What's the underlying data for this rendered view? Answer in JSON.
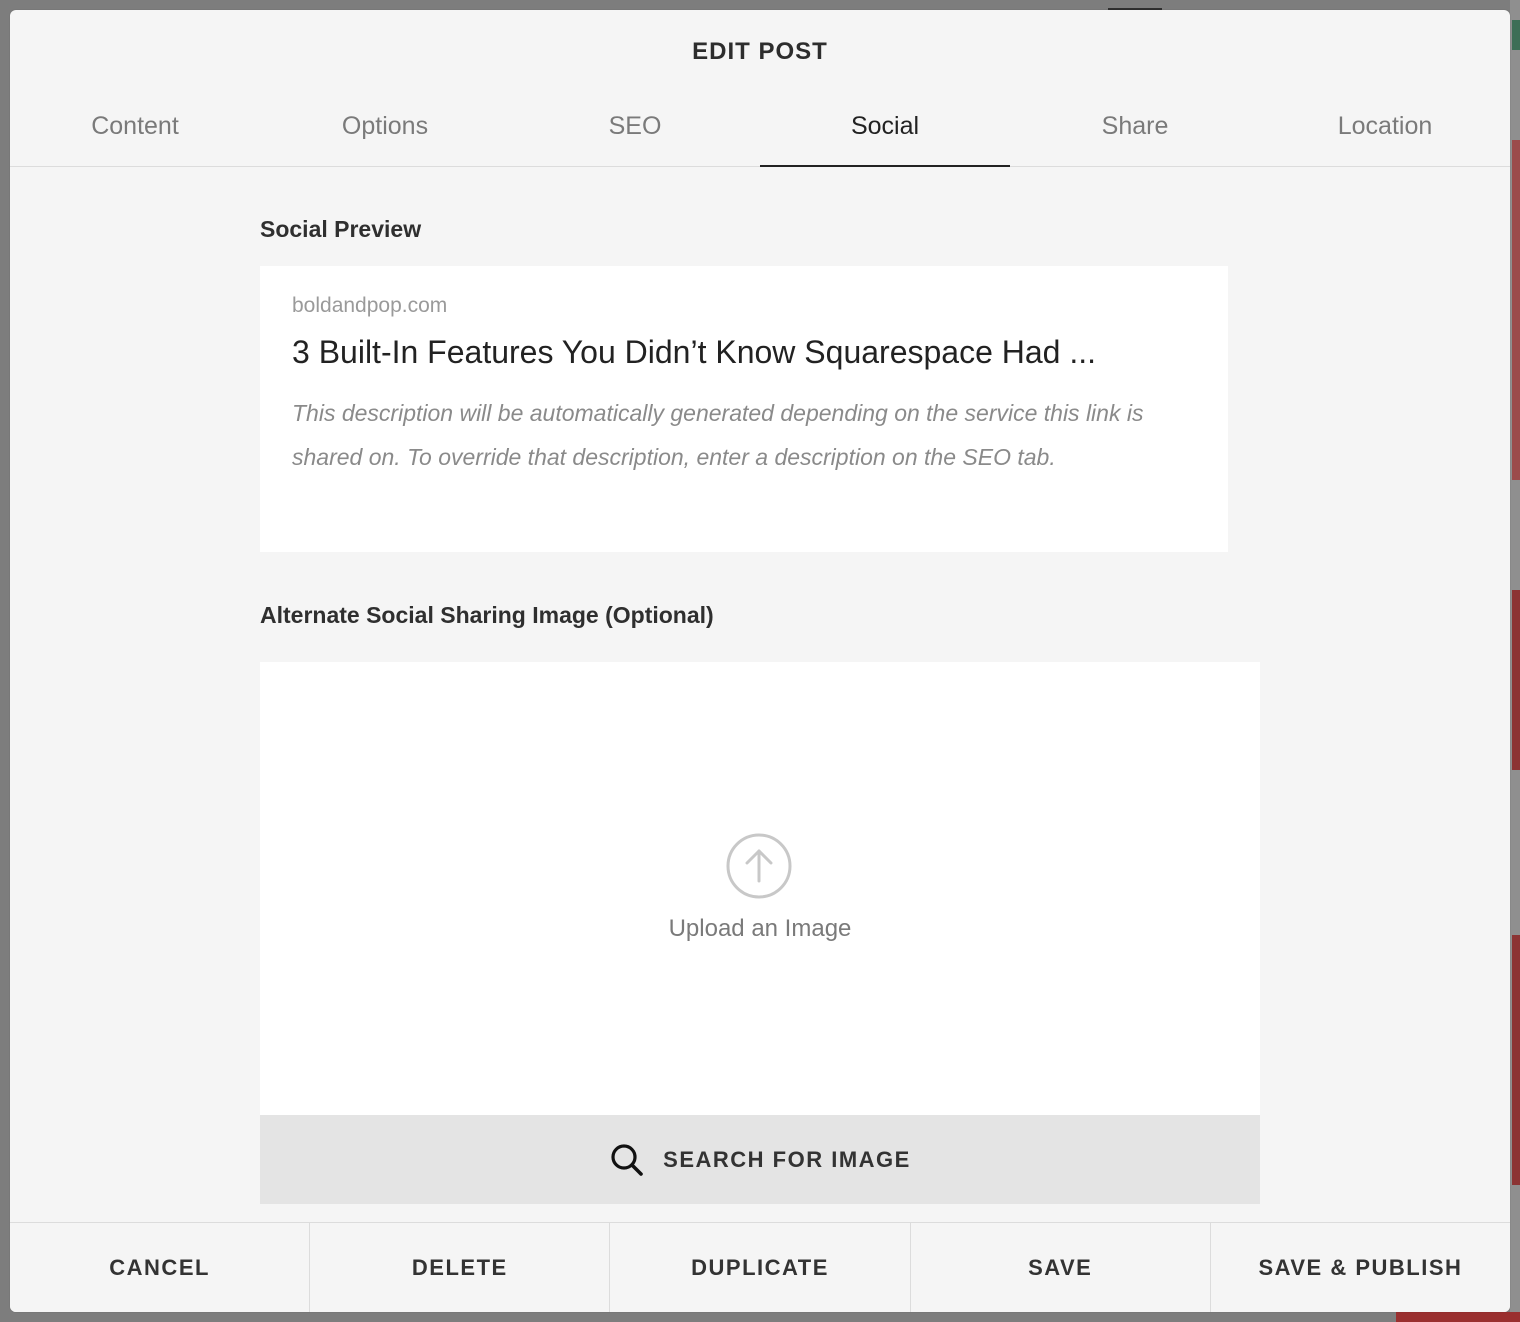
{
  "modal": {
    "title": "EDIT POST"
  },
  "tabs": [
    {
      "label": "Content",
      "active": false
    },
    {
      "label": "Options",
      "active": false
    },
    {
      "label": "SEO",
      "active": false
    },
    {
      "label": "Social",
      "active": true
    },
    {
      "label": "Share",
      "active": false
    },
    {
      "label": "Location",
      "active": false
    }
  ],
  "social_preview": {
    "heading": "Social Preview",
    "domain": "boldandpop.com",
    "title": "3 Built-In Features You Didn’t Know Squarespace Had ...",
    "description": "This description will be automatically generated depending on the service this link is shared on. To override that description, enter a description on the SEO tab."
  },
  "alternate_image": {
    "heading": "Alternate Social Sharing Image (Optional)",
    "upload_label": "Upload an Image",
    "upload_icon": "upload-arrow-circle-icon",
    "search_label": "SEARCH FOR IMAGE",
    "search_icon": "search-icon"
  },
  "footer": {
    "cancel": "CANCEL",
    "delete": "DELETE",
    "duplicate": "DUPLICATE",
    "save": "SAVE",
    "save_publish": "SAVE & PUBLISH"
  },
  "colors": {
    "modal_bg": "#f5f5f5",
    "card_bg": "#ffffff",
    "search_bar_bg": "#e4e4e4",
    "active_tab_underline": "#222222"
  }
}
